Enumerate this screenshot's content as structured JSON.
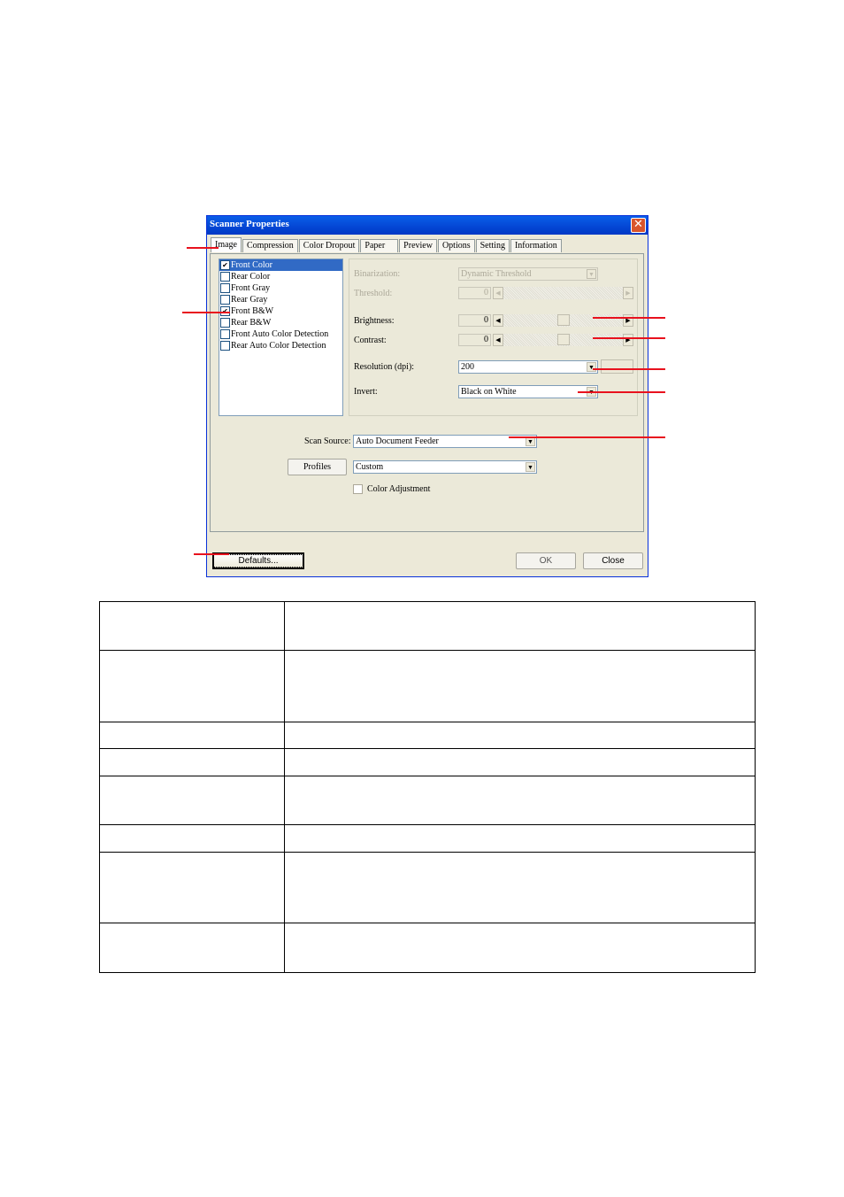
{
  "dialog": {
    "title": "Scanner Properties",
    "close_glyph": "✕",
    "tabs": [
      {
        "label": "Image",
        "active": true
      },
      {
        "label": "Compression",
        "active": false
      },
      {
        "label": "Color Dropout",
        "active": false
      },
      {
        "label": "Paper",
        "active": false
      },
      {
        "label": "Preview",
        "active": false
      },
      {
        "label": "Options",
        "active": false
      },
      {
        "label": "Setting",
        "active": false
      },
      {
        "label": "Information",
        "active": false
      }
    ],
    "image_types": [
      {
        "label": "Front Color",
        "checked": true,
        "selected": true
      },
      {
        "label": "Rear Color",
        "checked": false,
        "selected": false
      },
      {
        "label": "Front Gray",
        "checked": false,
        "selected": false
      },
      {
        "label": "Rear Gray",
        "checked": false,
        "selected": false
      },
      {
        "label": "Front B&W",
        "checked": true,
        "selected": false
      },
      {
        "label": "Rear B&W",
        "checked": false,
        "selected": false
      },
      {
        "label": "Front Auto Color Detection",
        "checked": false,
        "selected": false
      },
      {
        "label": "Rear Auto Color Detection",
        "checked": false,
        "selected": false
      }
    ],
    "settings": {
      "binarization": {
        "label": "Binarization:",
        "value": "Dynamic Threshold",
        "enabled": false
      },
      "threshold": {
        "label": "Threshold:",
        "value": "0",
        "enabled": false
      },
      "brightness": {
        "label": "Brightness:",
        "value": "0",
        "slider_fraction": 0.5
      },
      "contrast": {
        "label": "Contrast:",
        "value": "0",
        "slider_fraction": 0.5
      },
      "resolution": {
        "label": "Resolution (dpi):",
        "value": "200"
      },
      "invert": {
        "label": "Invert:",
        "value": "Black on White"
      }
    },
    "scan_source": {
      "label": "Scan Source:",
      "value": "Auto Document Feeder"
    },
    "profiles": {
      "button_label": "Profiles",
      "value": "Custom"
    },
    "color_adjustment": {
      "label": "Color Adjustment",
      "checked": false
    },
    "buttons": {
      "defaults": "Defaults...",
      "ok": "OK",
      "close": "Close"
    },
    "arrow_down": "▼",
    "arrow_left": "◀",
    "arrow_right": "▶",
    "check_glyph": "✔"
  },
  "description_table": {
    "rows": [
      [
        "",
        ""
      ],
      [
        "",
        ""
      ],
      [
        "",
        ""
      ],
      [
        "",
        ""
      ],
      [
        "",
        ""
      ],
      [
        "",
        ""
      ],
      [
        "",
        ""
      ],
      [
        "",
        ""
      ]
    ]
  }
}
